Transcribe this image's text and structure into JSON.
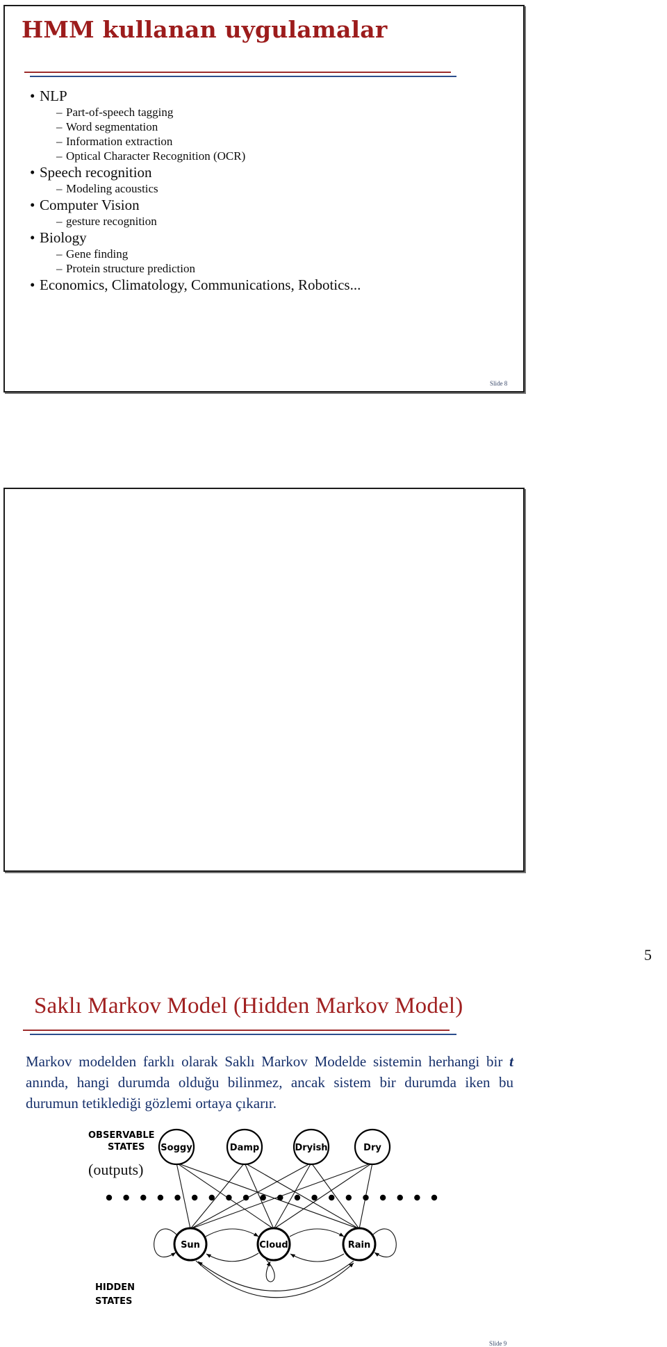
{
  "document": {
    "page_number": "5"
  },
  "slides": [
    {
      "id": "slide-8",
      "title": "HMM kullanan uygulamalar",
      "slide_label": "Slide 8",
      "bullets": [
        {
          "level": 1,
          "marker": "•",
          "text": "NLP"
        },
        {
          "level": 2,
          "marker": "–",
          "text": "Part-of-speech tagging"
        },
        {
          "level": 2,
          "marker": "–",
          "text": "Word segmentation"
        },
        {
          "level": 2,
          "marker": "–",
          "text": "Information extraction"
        },
        {
          "level": 2,
          "marker": "–",
          "text": "Optical Character Recognition (OCR)"
        },
        {
          "level": 1,
          "marker": "•",
          "text": "Speech recognition"
        },
        {
          "level": 2,
          "marker": "–",
          "text": "Modeling acoustics"
        },
        {
          "level": 1,
          "marker": "•",
          "text": "Computer Vision"
        },
        {
          "level": 2,
          "marker": "–",
          "text": "gesture recognition"
        },
        {
          "level": 1,
          "marker": "•",
          "text": "Biology"
        },
        {
          "level": 2,
          "marker": "–",
          "text": "Gene finding"
        },
        {
          "level": 2,
          "marker": "–",
          "text": "Protein structure prediction"
        },
        {
          "level": 1,
          "marker": "•",
          "text": "Economics, Climatology, Communications, Robotics..."
        }
      ]
    },
    {
      "id": "slide-9",
      "title": "Saklı Markov Model (Hidden Markov Model)",
      "slide_label": "Slide 9",
      "body": {
        "part1": "Markov modelden farklı olarak Saklı Markov Modelde sistemin herhangi bir ",
        "emphasis": "t",
        "part2": " anında, hangi durumda olduğu bilinmez, ancak sistem bir durumda iken bu durumun tetiklediği gözlemi ortaya çıkarır."
      },
      "diagram": {
        "observable_label_line1": "OBSERVABLE",
        "observable_label_line2": "STATES",
        "observable_sublabel": "(outputs)",
        "hidden_label_line1": "HIDDEN",
        "hidden_label_line2": "STATES",
        "observable_states": [
          "Soggy",
          "Damp",
          "Dryish",
          "Dry"
        ],
        "hidden_states": [
          "Sun",
          "Cloud",
          "Rain"
        ],
        "dot_count": 20
      }
    }
  ],
  "colors": {
    "title_red": "#9c1c1c",
    "body_navy": "#16306b",
    "rule_red": "#9c2b2b",
    "rule_blue": "#2b4d8c",
    "slide_number": "#3b4a6b"
  }
}
